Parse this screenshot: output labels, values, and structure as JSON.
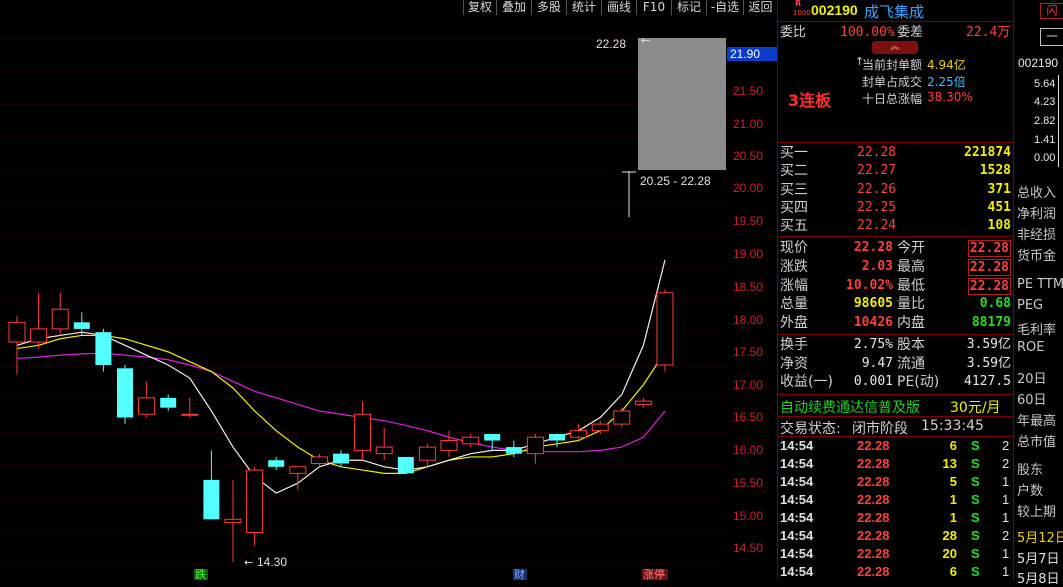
{
  "toolbar": {
    "items": [
      "复权",
      "叠加",
      "多股",
      "统计",
      "画线",
      "F10",
      "标记",
      "-自选",
      "返回"
    ]
  },
  "chart_data": {
    "type": "candlestick",
    "yticks": [
      "21.90",
      "21.50",
      "21.00",
      "20.50",
      "20.00",
      "19.50",
      "19.00",
      "18.50",
      "18.00",
      "17.50",
      "17.00",
      "16.50",
      "16.00",
      "15.50",
      "15.00",
      "14.50"
    ],
    "current_price": "21.90",
    "high_marker": "22.28",
    "low_marker": "14.30",
    "range_label": "20.25 - 22.28",
    "candles": [
      {
        "o": 17.65,
        "c": 17.95,
        "h": 18.05,
        "l": 17.15
      },
      {
        "o": 17.65,
        "c": 17.85,
        "h": 18.4,
        "l": 17.55
      },
      {
        "o": 17.85,
        "c": 18.15,
        "h": 18.4,
        "l": 17.75
      },
      {
        "o": 17.95,
        "c": 17.85,
        "h": 18.1,
        "l": 17.75
      },
      {
        "o": 17.8,
        "c": 17.3,
        "h": 17.85,
        "l": 17.2
      },
      {
        "o": 17.25,
        "c": 16.5,
        "h": 17.3,
        "l": 16.4
      },
      {
        "o": 16.55,
        "c": 16.8,
        "h": 17.05,
        "l": 16.5
      },
      {
        "o": 16.8,
        "c": 16.65,
        "h": 16.85,
        "l": 16.6
      },
      {
        "o": 16.55,
        "c": 16.55,
        "h": 16.8,
        "l": 16.5
      },
      {
        "o": 15.55,
        "c": 14.95,
        "h": 16.0,
        "l": 14.95
      },
      {
        "o": 14.9,
        "c": 14.95,
        "h": 15.55,
        "l": 14.3
      },
      {
        "o": 14.75,
        "c": 15.7,
        "h": 15.75,
        "l": 14.55
      },
      {
        "o": 15.85,
        "c": 15.75,
        "h": 15.9,
        "l": 15.7
      },
      {
        "o": 15.65,
        "c": 15.75,
        "h": 15.75,
        "l": 15.4
      },
      {
        "o": 15.8,
        "c": 15.9,
        "h": 15.95,
        "l": 15.75
      },
      {
        "o": 15.95,
        "c": 15.8,
        "h": 16.0,
        "l": 15.75
      },
      {
        "o": 16.0,
        "c": 16.55,
        "h": 16.75,
        "l": 15.85
      },
      {
        "o": 15.95,
        "c": 16.05,
        "h": 16.35,
        "l": 15.85
      },
      {
        "o": 15.9,
        "c": 15.65,
        "h": 15.9,
        "l": 15.65
      },
      {
        "o": 15.85,
        "c": 16.05,
        "h": 16.1,
        "l": 15.75
      },
      {
        "o": 16.0,
        "c": 16.15,
        "h": 16.3,
        "l": 15.9
      },
      {
        "o": 16.1,
        "c": 16.2,
        "h": 16.25,
        "l": 16.05
      },
      {
        "o": 16.25,
        "c": 16.15,
        "h": 16.25,
        "l": 16.0
      },
      {
        "o": 16.05,
        "c": 15.95,
        "h": 16.15,
        "l": 15.9
      },
      {
        "o": 15.95,
        "c": 16.2,
        "h": 16.25,
        "l": 15.8
      },
      {
        "o": 16.25,
        "c": 16.15,
        "h": 16.25,
        "l": 16.05
      },
      {
        "o": 16.2,
        "c": 16.3,
        "h": 16.4,
        "l": 16.15
      },
      {
        "o": 16.3,
        "c": 16.4,
        "h": 16.45,
        "l": 16.25
      },
      {
        "o": 16.4,
        "c": 16.6,
        "h": 16.65,
        "l": 16.35
      },
      {
        "o": 16.7,
        "c": 16.75,
        "h": 16.8,
        "l": 16.65
      },
      {
        "o": 17.3,
        "c": 18.4,
        "h": 18.45,
        "l": 17.2
      }
    ],
    "ma5": [
      17.6,
      17.7,
      17.75,
      17.8,
      17.75,
      17.6,
      17.45,
      17.3,
      17.1,
      16.6,
      16.05,
      15.6,
      15.35,
      15.5,
      15.75,
      15.85,
      15.85,
      15.75,
      15.7,
      15.75,
      15.85,
      15.95,
      16.0,
      16.0,
      16.1,
      16.2,
      16.3,
      16.5,
      16.85,
      17.6,
      18.9
    ],
    "ma10": [
      17.55,
      17.6,
      17.7,
      17.75,
      17.75,
      17.7,
      17.6,
      17.5,
      17.35,
      17.2,
      16.95,
      16.6,
      16.3,
      16.05,
      15.85,
      15.75,
      15.7,
      15.65,
      15.65,
      15.75,
      15.85,
      15.9,
      15.9,
      15.95,
      16.05,
      16.1,
      16.15,
      16.3,
      16.6,
      17.0,
      17.5
    ],
    "ma20": [
      17.4,
      17.42,
      17.45,
      17.47,
      17.48,
      17.45,
      17.42,
      17.38,
      17.3,
      17.2,
      17.05,
      16.9,
      16.8,
      16.7,
      16.6,
      16.55,
      16.5,
      16.45,
      16.38,
      16.3,
      16.2,
      16.12,
      16.05,
      16.0,
      15.98,
      15.98,
      15.98,
      16.0,
      16.05,
      16.2,
      16.6
    ],
    "bottom_markers": [
      "跌",
      "财",
      "涨停"
    ]
  },
  "header": {
    "code": "002190",
    "name": "成飞集成",
    "r_mark": "R",
    "r_sub": "1000"
  },
  "ratio_row": {
    "weibi_label": "委比",
    "weibi_value": "100.00%",
    "weicha_label": "委差",
    "weicha_value": "22.4万"
  },
  "limit_info": {
    "badge": "3连板",
    "rows": [
      {
        "label": "当前封单额",
        "value": "4.94亿"
      },
      {
        "label": "封单占成交",
        "value": "2.25倍"
      },
      {
        "label": "十日总涨幅",
        "value": "38.30%"
      }
    ]
  },
  "bids": [
    {
      "label": "买一",
      "price": "22.28",
      "vol": "221874"
    },
    {
      "label": "买二",
      "price": "22.27",
      "vol": "1528"
    },
    {
      "label": "买三",
      "price": "22.26",
      "vol": "371"
    },
    {
      "label": "买四",
      "price": "22.25",
      "vol": "451"
    },
    {
      "label": "买五",
      "price": "22.24",
      "vol": "108"
    }
  ],
  "quote_rows": [
    {
      "l1": "现价",
      "v1": "22.28",
      "l2": "今开",
      "v2": "22.28"
    },
    {
      "l1": "涨跌",
      "v1": "2.03",
      "l2": "最高",
      "v2": "22.28"
    },
    {
      "l1": "涨幅",
      "v1": "10.02%",
      "l2": "最低",
      "v2": "22.28"
    },
    {
      "l1": "总量",
      "v1": "98605",
      "l2": "量比",
      "v2": "0.68"
    },
    {
      "l1": "外盘",
      "v1": "10426",
      "l2": "内盘",
      "v2": "88179"
    }
  ],
  "stats_rows": [
    {
      "l1": "换手",
      "v1": "2.75%",
      "l2": "股本",
      "v2": "3.59亿"
    },
    {
      "l1": "净资",
      "v1": "9.47",
      "l2": "流通",
      "v2": "3.59亿"
    },
    {
      "l1": "收益(一)",
      "v1": "0.001",
      "l2": "PE(动)",
      "v2": "4127.5"
    }
  ],
  "promo": {
    "text": "自动续费通达信普及版",
    "price": "30元/月"
  },
  "trade_status": {
    "label": "交易状态:",
    "value": "闭市阶段",
    "time": "15:33:45"
  },
  "ticks": [
    {
      "time": "14:54",
      "price": "22.28",
      "vol": "6",
      "side": "S",
      "n": "2"
    },
    {
      "time": "14:54",
      "price": "22.28",
      "vol": "13",
      "side": "S",
      "n": "2"
    },
    {
      "time": "14:54",
      "price": "22.28",
      "vol": "5",
      "side": "S",
      "n": "1"
    },
    {
      "time": "14:54",
      "price": "22.28",
      "vol": "1",
      "side": "S",
      "n": "1"
    },
    {
      "time": "14:54",
      "price": "22.28",
      "vol": "1",
      "side": "S",
      "n": "1"
    },
    {
      "time": "14:54",
      "price": "22.28",
      "vol": "28",
      "side": "S",
      "n": "2"
    },
    {
      "time": "14:54",
      "price": "22.28",
      "vol": "20",
      "side": "S",
      "n": "1"
    },
    {
      "time": "14:54",
      "price": "22.28",
      "vol": "6",
      "side": "S",
      "n": "1"
    }
  ],
  "far_panel": {
    "tab1": "闪",
    "tab2": "一",
    "code": "002190",
    "ind_values": [
      "5.64",
      "4.23",
      "2.82",
      "1.41",
      "0.00"
    ],
    "items": [
      "总收入",
      "净利润",
      "非经损",
      "货币金",
      "PE TTM",
      "PEG",
      "毛利率",
      "ROE",
      "20日",
      "60日",
      "年最高",
      "总市值",
      "股东",
      "户数",
      "较上期",
      "5月12日",
      "5月7日",
      "5月8日"
    ]
  }
}
